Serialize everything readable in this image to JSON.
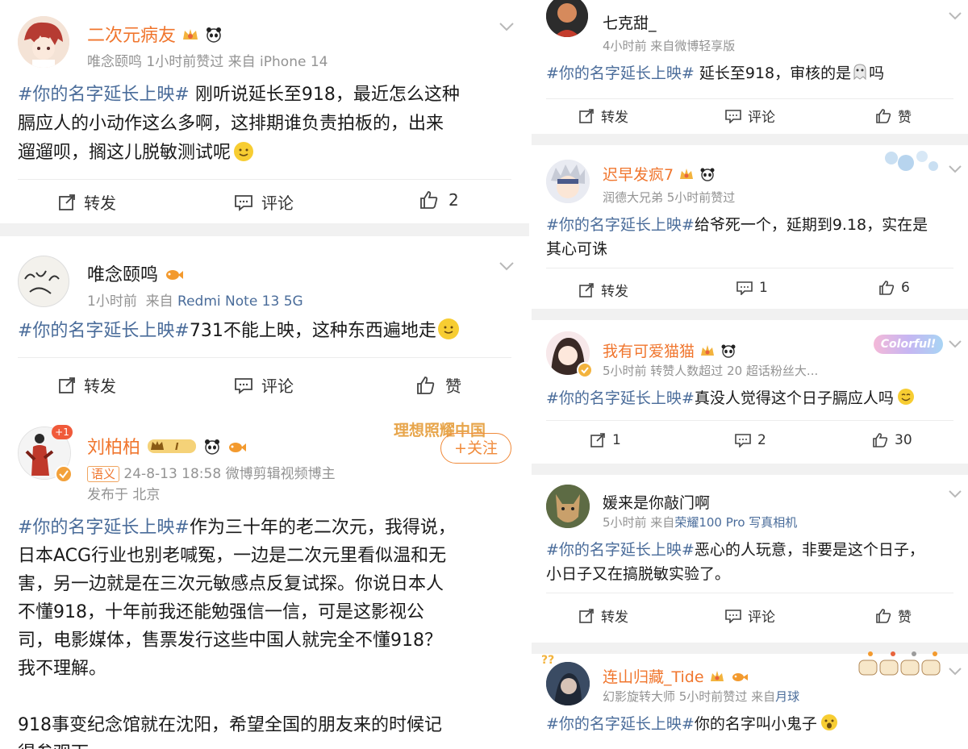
{
  "left": {
    "posts": [
      {
        "name": "二次元病友",
        "meta": "唯念颐鸣 1小时前赞过",
        "source_prefix": "来自",
        "source": "iPhone 14",
        "hashtag": "#你的名字延长上映#",
        "lines": [
          "刚听说延长至918，最近怎么这种",
          "膈应人的小动作这么多啊，这排期谁负责拍板的，出来",
          "遛遛呗，搁这儿脱敏测试呢"
        ],
        "repost": "转发",
        "comment": "评论",
        "like": "2"
      },
      {
        "name": "唯念颐鸣",
        "time": "1小时前",
        "source_prefix": "来自",
        "source": "Redmi Note 13 5G",
        "hashtag": "#你的名字延长上映#",
        "text": "731不能上映，这种东西遍地走",
        "repost": "转发",
        "comment": "评论",
        "like": "赞"
      },
      {
        "name": "刘柏柏",
        "avatar_badge": "+1",
        "level": "I",
        "follow": "+关注",
        "watermark": "理想照耀中国",
        "label": "语义",
        "meta": "24-8-13 18:58  微博剪辑视频博主",
        "location": "发布于 北京",
        "hashtag": "#你的名字延长上映#",
        "lines": [
          "作为三十年的老二次元，我得说，",
          "日本ACG行业也别老喊冤，一边是二次元里看似温和无",
          "害，另一边就是在三次元敏感点反复试探。你说日本人",
          "不懂918，十年前我还能勉强信一信，可是这影视公",
          "司，电影媒体，售票发行这些中国人就完全不懂918？",
          "我不理解。",
          "",
          "918事变纪念馆就在沈阳，希望全国的朋友来的时候记",
          "得参观下"
        ]
      }
    ]
  },
  "right": {
    "posts": [
      {
        "name": "七克甜_",
        "meta": "4小时前  来自微博轻享版",
        "hashtag": "#你的名字延长上映#",
        "text": " 延长至918，审核的是",
        "text_end": "吗",
        "repost": "转发",
        "comment": "评论",
        "like": "赞"
      },
      {
        "name": "迟早发疯7",
        "meta": "润德大兄弟 5小时前赞过",
        "hashtag": "#你的名字延长上映#",
        "text": "给爷死一个，延期到9.18，实在是",
        "line2": "其心可诛",
        "repost": "转发",
        "comment": "1",
        "like": "6"
      },
      {
        "name": "我有可爱猫猫",
        "sticker": "Colorful!",
        "meta": "5小时前  转赞人数超过 20  超话粉丝大...",
        "hashtag": "#你的名字延长上映#",
        "text": "真没人觉得这个日子膈应人吗",
        "repost": "1",
        "comment": "2",
        "like": "30"
      },
      {
        "name": "媛来是你敲门啊",
        "meta": "5小时前  来自",
        "source": "荣耀100 Pro 写真相机",
        "hashtag": "#你的名字延长上映#",
        "text": "恶心的人玩意，非要是这个日子，",
        "line2": "小日子又在搞脱敏实验了。",
        "repost": "转发",
        "comment": "评论",
        "like": "赞"
      },
      {
        "name": "连山归藏_Tide",
        "meta": "幻影旋转大师 5小时前赞过  来自",
        "source": "月球",
        "hashtag": "#你的名字延长上映#",
        "text": "你的名字叫小鬼子"
      }
    ]
  },
  "colors": {
    "link": "#4a6c9a",
    "vip_name": "#f0762e",
    "meta": "#939393",
    "gap": "#f1f1f1"
  }
}
